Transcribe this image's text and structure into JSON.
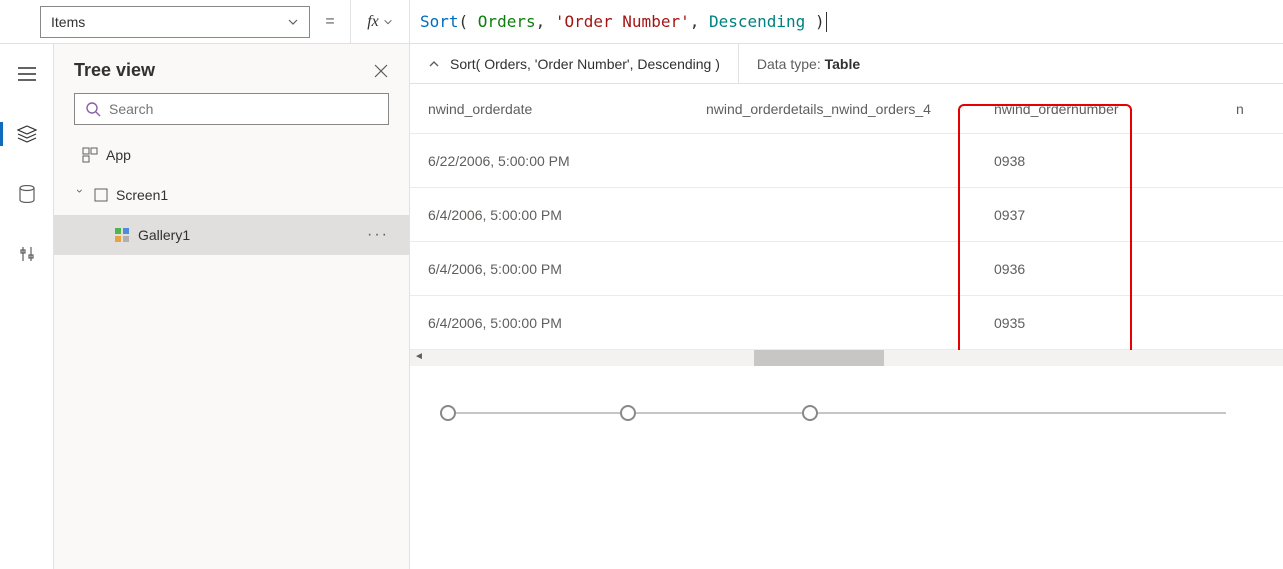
{
  "property": {
    "selected": "Items"
  },
  "formula": {
    "fn": "Sort",
    "id": "Orders",
    "str": "'Order Number'",
    "kw": "Descending",
    "display": "Sort( Orders, 'Order Number', Descending )"
  },
  "result": {
    "expr": "Sort( Orders, 'Order Number', Descending )",
    "dataTypeLabel": "Data type: ",
    "dataTypeValue": "Table"
  },
  "tree": {
    "title": "Tree view",
    "searchPlaceholder": "Search",
    "app": "App",
    "screen": "Screen1",
    "gallery": "Gallery1"
  },
  "table": {
    "headers": {
      "date": "nwind_orderdate",
      "details": "nwind_orderdetails_nwind_orders_4",
      "num": "nwind_ordernumber",
      "last": "n"
    },
    "rows": [
      {
        "date": "6/22/2006, 5:00:00 PM",
        "num": "0938"
      },
      {
        "date": "6/4/2006, 5:00:00 PM",
        "num": "0937"
      },
      {
        "date": "6/4/2006, 5:00:00 PM",
        "num": "0936"
      },
      {
        "date": "6/4/2006, 5:00:00 PM",
        "num": "0935"
      }
    ]
  }
}
